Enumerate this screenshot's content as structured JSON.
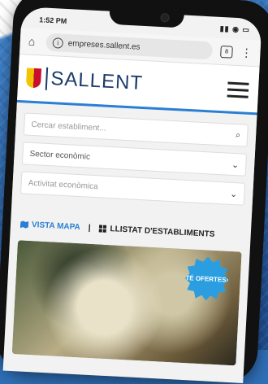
{
  "status": {
    "time": "1:52 PM",
    "icons": "▮▮ ◉ ▭"
  },
  "browser": {
    "url": "empreses.sallent.es",
    "tab_count": "8"
  },
  "site": {
    "logo_text": "SALLENT"
  },
  "filters": {
    "search_placeholder": "Cercar establiment...",
    "sector_label": "Sector econòmic",
    "activity_label": "Activitat econòmica"
  },
  "views": {
    "map_label": "VISTA MAPA",
    "separator": "|",
    "list_label": "LLISTAT D'ESTABLIMENTS"
  },
  "card": {
    "badge_text": "TÉ OFERTES!"
  },
  "icons": [
    "home-icon",
    "info-icon",
    "tabs-icon",
    "menu-dots-icon",
    "hamburger-icon",
    "search-icon",
    "chevron-down-icon",
    "map-icon",
    "grid-icon"
  ],
  "colors": {
    "accent": "#2a7fd4",
    "badge": "#2a9ee0",
    "logo": "#1a3a6b"
  }
}
